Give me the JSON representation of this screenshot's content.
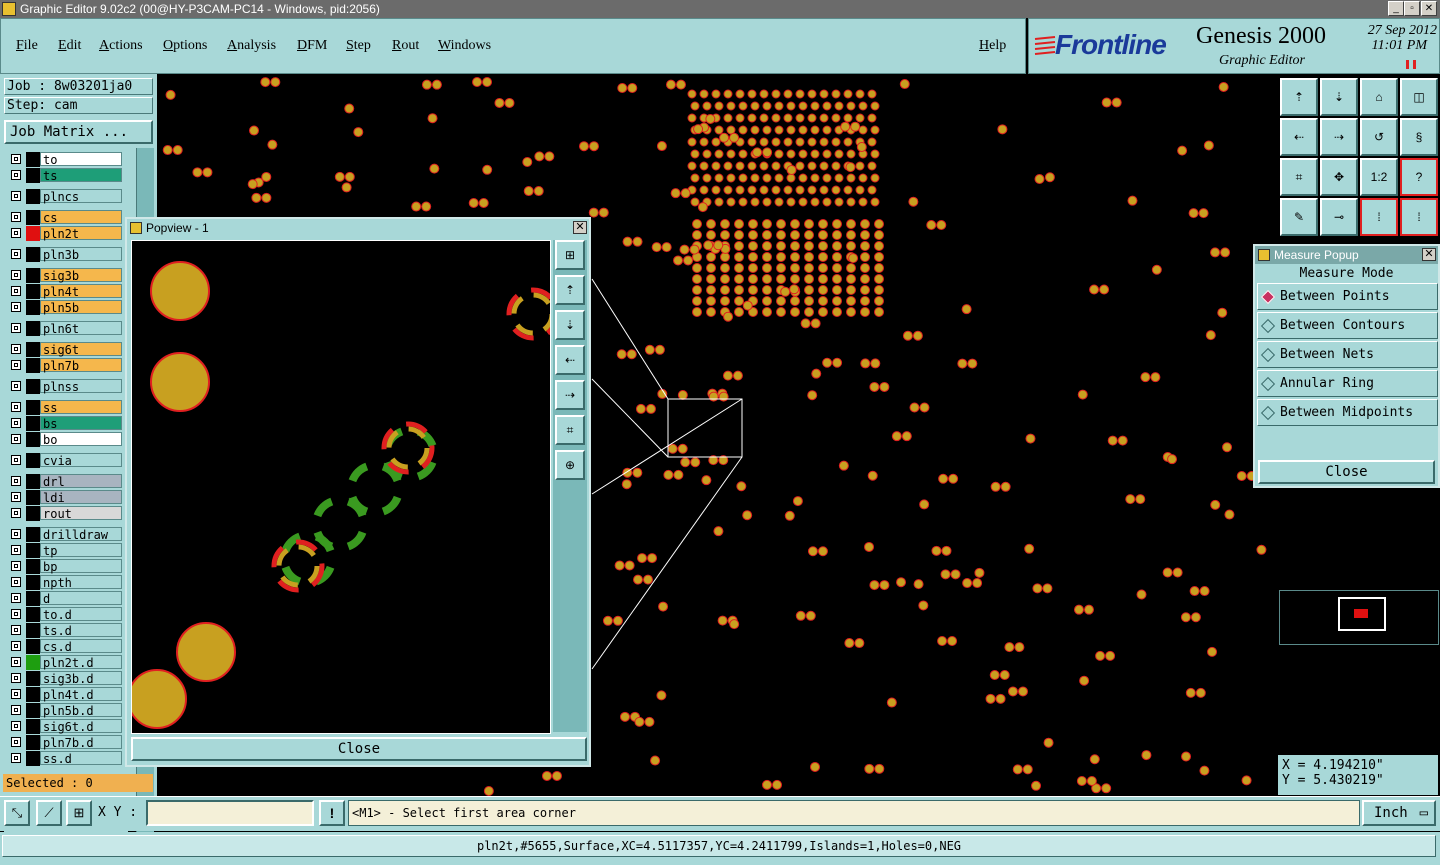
{
  "window": {
    "title": "Graphic Editor 9.02c2 (00@HY-P3CAM-PC14 - Windows, pid:2056)"
  },
  "menu": [
    "File",
    "Edit",
    "Actions",
    "Options",
    "Analysis",
    "DFM",
    "Step",
    "Rout",
    "Windows"
  ],
  "help": "Help",
  "brand": {
    "logo": "Frontline",
    "product": "Genesis 2000",
    "subtitle": "Graphic Editor",
    "date": "27 Sep 2012",
    "time": "11:01 PM"
  },
  "job": {
    "job_line": "Job : 8w03201ja0",
    "step_line": "Step: cam",
    "matrix_button": "Job Matrix ..."
  },
  "layers": [
    {
      "name": "to",
      "color": "#ffffff",
      "swatch": "#000000"
    },
    {
      "name": "ts",
      "color": "#1e9e78",
      "swatch": "#000000"
    },
    {
      "name": "plncs",
      "color": "#a8d8d8",
      "swatch": "#000000"
    },
    {
      "name": "cs",
      "color": "#f5b74c",
      "swatch": "#000000"
    },
    {
      "name": "pln2t",
      "color": "#f5b74c",
      "swatch": "#e01010"
    },
    {
      "name": "pln3b",
      "color": "#a8d8d8",
      "swatch": "#000000"
    },
    {
      "name": "sig3b",
      "color": "#f5b74c",
      "swatch": "#000000"
    },
    {
      "name": "pln4t",
      "color": "#f5b74c",
      "swatch": "#000000"
    },
    {
      "name": "pln5b",
      "color": "#f5b74c",
      "swatch": "#000000"
    },
    {
      "name": "pln6t",
      "color": "#a8d8d8",
      "swatch": "#000000"
    },
    {
      "name": "sig6t",
      "color": "#f5b74c",
      "swatch": "#000000"
    },
    {
      "name": "pln7b",
      "color": "#f5b74c",
      "swatch": "#000000"
    },
    {
      "name": "plnss",
      "color": "#a8d8d8",
      "swatch": "#000000"
    },
    {
      "name": "ss",
      "color": "#f5b74c",
      "swatch": "#000000"
    },
    {
      "name": "bs",
      "color": "#1e9e78",
      "swatch": "#000000"
    },
    {
      "name": "bo",
      "color": "#ffffff",
      "swatch": "#000000"
    },
    {
      "name": "cvia",
      "color": "#a8d8d8",
      "swatch": "#000000"
    },
    {
      "name": "drl",
      "color": "#a8b4c0",
      "swatch": "#000000"
    },
    {
      "name": "ldi",
      "color": "#a8b4c0",
      "swatch": "#000000"
    },
    {
      "name": "rout",
      "color": "#d8d8d8",
      "swatch": "#000000"
    },
    {
      "name": "drilldraw",
      "color": "#a8d8d8",
      "swatch": "#000000"
    },
    {
      "name": "tp",
      "color": "#a8d8d8",
      "swatch": "#000000"
    },
    {
      "name": "bp",
      "color": "#a8d8d8",
      "swatch": "#000000"
    },
    {
      "name": "npth",
      "color": "#a8d8d8",
      "swatch": "#000000"
    },
    {
      "name": "d",
      "color": "#a8d8d8",
      "swatch": "#000000"
    },
    {
      "name": "to.d",
      "color": "#a8d8d8",
      "swatch": "#000000"
    },
    {
      "name": "ts.d",
      "color": "#a8d8d8",
      "swatch": "#000000"
    },
    {
      "name": "cs.d",
      "color": "#a8d8d8",
      "swatch": "#000000"
    },
    {
      "name": "pln2t.d",
      "color": "#a8d8d8",
      "swatch": "#1e9e10"
    },
    {
      "name": "sig3b.d",
      "color": "#a8d8d8",
      "swatch": "#000000"
    },
    {
      "name": "pln4t.d",
      "color": "#a8d8d8",
      "swatch": "#000000"
    },
    {
      "name": "pln5b.d",
      "color": "#a8d8d8",
      "swatch": "#000000"
    },
    {
      "name": "sig6t.d",
      "color": "#a8d8d8",
      "swatch": "#000000"
    },
    {
      "name": "pln7b.d",
      "color": "#a8d8d8",
      "swatch": "#000000"
    },
    {
      "name": "ss.d",
      "color": "#a8d8d8",
      "swatch": "#000000"
    }
  ],
  "selected": "Selected : 0",
  "popview": {
    "title": "Popview - 1",
    "close": "Close"
  },
  "measure": {
    "title": "Measure Popup",
    "heading": "Measure Mode",
    "options": [
      "Between Points",
      "Between Contours",
      "Between Nets",
      "Annular Ring",
      "Between Midpoints"
    ],
    "close": "Close"
  },
  "coords": {
    "x": "X = 4.194210\"",
    "y": "Y = 5.430219\""
  },
  "bottom": {
    "xy_label": "X Y :",
    "xy_value": "",
    "prompt": "<M1> - Select first area corner",
    "unit": "Inch"
  },
  "status": "pln2t,#5655,Surface,XC=4.5117357,YC=4.2411799,Islands=1,Holes=0,NEG",
  "colors": {
    "panel": "#a8d8d8",
    "pad": "#c8a020",
    "pad_outline": "#e02020",
    "thermal": "#3a9a20"
  }
}
